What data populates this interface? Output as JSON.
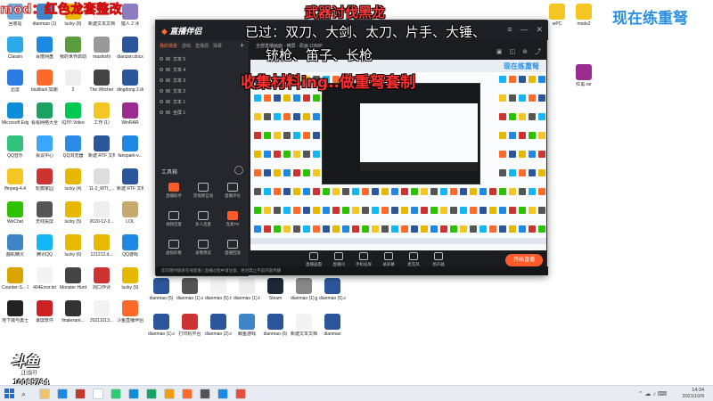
{
  "overlay": {
    "mod_title": "mod：红色龙套整改",
    "weapon_title": "武器讨伐黑龙",
    "current_title": "现在练重弩",
    "passed_line1": "已过：双刀、大剑、太刀、片手、大锤、",
    "passed_line2": "铳枪、笛子、长枪",
    "collect_line": "收集材料ing..做重弩套制"
  },
  "desktop_icons": [
    {
      "label": "回收站",
      "color": "#6fa8dc"
    },
    {
      "label": "dianmao (1)",
      "color": "#3d85c6"
    },
    {
      "label": "lucky (8)",
      "color": "#e6b800"
    },
    {
      "label": "新建文本文档",
      "color": "#f3f3f3"
    },
    {
      "label": "猎人 2 冰",
      "color": "#8e7cc3"
    },
    {
      "label": "Classin",
      "color": "#2ea9e8"
    },
    {
      "label": "百度网盘",
      "color": "#1e88e5"
    },
    {
      "label": "我的世界启动器",
      "color": "#5b9c3c"
    },
    {
      "label": "mashishi",
      "color": "#999999"
    },
    {
      "label": "dianzan.docx",
      "color": "#2b579a"
    },
    {
      "label": "迅雷",
      "color": "#2c7be5"
    },
    {
      "label": "biulibiuli 加速器",
      "color": "#ff6a2b"
    },
    {
      "label": "2",
      "color": "#eeeeee"
    },
    {
      "label": "The Witcher",
      "color": "#444444"
    },
    {
      "label": "dingdong 2.docx",
      "color": "#2b579a"
    },
    {
      "label": "Microsoft Edge",
      "color": "#0c8ed9"
    },
    {
      "label": "看看网络大全",
      "color": "#1aa260"
    },
    {
      "label": "IQIYI Video",
      "color": "#00c853"
    },
    {
      "label": "工作 (1)",
      "color": "#f3c623"
    },
    {
      "label": "WinRAR",
      "color": "#9b2c8d"
    },
    {
      "label": "QQ音乐",
      "color": "#31c27c"
    },
    {
      "label": "会议中心",
      "color": "#3aa7ff"
    },
    {
      "label": "QQ浏览器",
      "color": "#2b8be6"
    },
    {
      "label": "新建 RTF 文档",
      "color": "#2b579a"
    },
    {
      "label": "fanspark-v...",
      "color": "#1e88e5"
    },
    {
      "label": "ffmpeg-4.4",
      "color": "#f3c623"
    },
    {
      "label": "轮廓家园",
      "color": "#cc3333"
    },
    {
      "label": "lucky (4)",
      "color": "#e6b800"
    },
    {
      "label": "11-2_WTI_...",
      "color": "#dddddd"
    },
    {
      "label": "新建 RTF 文档",
      "color": "#2b579a"
    },
    {
      "label": "WeChat",
      "color": "#2dc100"
    },
    {
      "label": "无线投屏",
      "color": "#555555"
    },
    {
      "label": "lucky (5)",
      "color": "#e6b800"
    },
    {
      "label": "2020-12-3...",
      "color": "#eeeeee"
    },
    {
      "label": "LOL",
      "color": "#c8aa6e"
    },
    {
      "label": "翻机精灵",
      "color": "#3d85c6"
    },
    {
      "label": "腾讯QQ",
      "color": "#12b7f5"
    },
    {
      "label": "lucky (6)",
      "color": "#e6b800"
    },
    {
      "label": "121212.d...",
      "color": "#e6b800"
    },
    {
      "label": "QQ游戏",
      "color": "#1e88e5"
    },
    {
      "label": "Counter-S... Global Offe...",
      "color": "#d9a400"
    },
    {
      "label": "404Error.txt",
      "color": "#f3f3f3"
    },
    {
      "label": "Monster Hunter...",
      "color": "#444444"
    },
    {
      "label": "周口作评",
      "color": "#cc3333"
    },
    {
      "label": "lucky (9)",
      "color": "#e6b800"
    },
    {
      "label": "地下城与勇士",
      "color": "#222222"
    },
    {
      "label": "录屏软件",
      "color": "#cc2222"
    },
    {
      "label": "finalexam...",
      "color": "#333333"
    },
    {
      "label": "20211013...",
      "color": "#f3f3f3"
    },
    {
      "label": "斗鱼直播伴侣",
      "color": "#ff6a2b"
    }
  ],
  "right_icons": [
    {
      "label": "wPC",
      "color": "#f3c623"
    },
    {
      "label": "mods2",
      "color": "#f3c623"
    },
    {
      "label": "红黑.rar",
      "color": "#9b2c8d"
    }
  ],
  "second_col_icons": [
    {
      "label": "dianmao (5)",
      "color": "#2b579a"
    },
    {
      "label": "dianmao (1).exe",
      "color": "#555555"
    },
    {
      "label": "dianmao (5).txt",
      "color": "#f3f3f3"
    },
    {
      "label": "dianmao (1).txt",
      "color": "#eeeeee"
    },
    {
      "label": "Steam",
      "color": "#1b2838"
    },
    {
      "label": "dianmao (1).jpg",
      "color": "#888888"
    },
    {
      "label": "dianmao (5).docx",
      "color": "#2b579a"
    },
    {
      "label": "dianmao (1).docx",
      "color": "#2b579a"
    },
    {
      "label": "打印机平台",
      "color": "#cc3333"
    },
    {
      "label": "dianmao (2).docx",
      "color": "#2b579a"
    },
    {
      "label": "鲸鱼游戏",
      "color": "#3d85c6"
    },
    {
      "label": "dianmao (6)",
      "color": "#2b579a"
    },
    {
      "label": "新建文本文档",
      "color": "#f3f3f3"
    },
    {
      "label": "dianmao",
      "color": "#2b579a"
    }
  ],
  "live_window": {
    "logo": "直播伴侣",
    "scene_tabs": [
      "我的场景",
      "游戏",
      "直播源",
      "弹幕"
    ],
    "sources": [
      "文本 5",
      "文本 4",
      "文本 3",
      "文本 2",
      "文本 1",
      "全屏 1"
    ],
    "tools_title": "工具箱",
    "tools": [
      {
        "label": "直播助手",
        "hot": true
      },
      {
        "label": "音视频互动",
        "hot": false
      },
      {
        "label": "直播评论",
        "hot": false
      },
      {
        "label": "视频连麦",
        "hot": false
      },
      {
        "label": "多人连麦",
        "hot": false
      },
      {
        "label": "连麦PK",
        "hot": true
      },
      {
        "label": "虚拟形象",
        "hot": false
      },
      {
        "label": "录像预览",
        "hot": false
      },
      {
        "label": "直播回放",
        "hot": false
      }
    ],
    "preview_title": "全部直播画面 · 横屏 · 原画 1080P",
    "preview_current": "现在练重弩",
    "controls": [
      {
        "label": "直播画面"
      },
      {
        "label": "直播间"
      },
      {
        "label": "手机投屏"
      },
      {
        "label": "录屏幕"
      },
      {
        "label": "麦克风"
      },
      {
        "label": "扬声器"
      }
    ],
    "start_live": "开始直播",
    "status": "您可随时联系在线客服 | 直播过程中请注意，绝对禁止不良内容传播"
  },
  "watermark": {
    "logo": "斗鱼",
    "name": "直播间",
    "room_id": "10085734"
  },
  "taskbar": {
    "time": "14:34",
    "date": "2021/10/9",
    "apps": [
      "#f0c36a",
      "#1e88e5",
      "#c0392b",
      "#ffffff",
      "#2ecc71",
      "#0c8ed9",
      "#1aa260",
      "#f39c12",
      "#ff6a2b",
      "#555555",
      "#1e88e5",
      "#e74c3c"
    ]
  }
}
